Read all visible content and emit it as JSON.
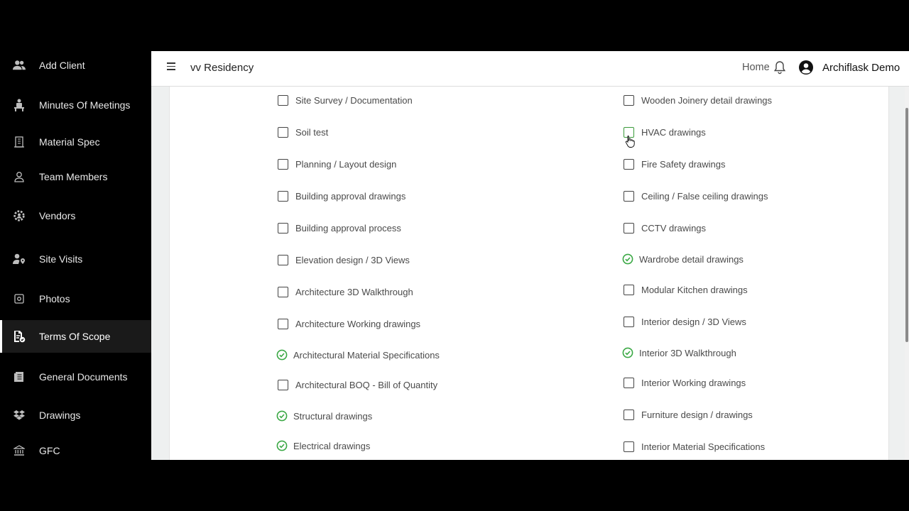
{
  "header": {
    "project_name": "vv Residency",
    "home_label": "Home",
    "user_name": "Archiflask Demo"
  },
  "sidebar": {
    "items": [
      {
        "label": "Add Client",
        "icon": "users-icon",
        "active": false
      },
      {
        "label": "Minutes Of Meetings",
        "icon": "meeting-icon",
        "active": false
      },
      {
        "label": "Material Spec",
        "icon": "building-icon",
        "active": false
      },
      {
        "label": "Team Members",
        "icon": "user-outline-icon",
        "active": false
      },
      {
        "label": "Vendors",
        "icon": "gear-user-icon",
        "active": false
      },
      {
        "label": "Site Visits",
        "icon": "user-location-icon",
        "active": false
      },
      {
        "label": "Photos",
        "icon": "photo-icon",
        "active": false
      },
      {
        "label": "Terms Of Scope",
        "icon": "document-check-icon",
        "active": true
      },
      {
        "label": "General Documents",
        "icon": "documents-icon",
        "active": false
      },
      {
        "label": "Drawings",
        "icon": "dropbox-icon",
        "active": false
      },
      {
        "label": "GFC",
        "icon": "bank-icon",
        "active": false
      }
    ]
  },
  "scope": {
    "left": [
      {
        "label": "Site Survey / Documentation",
        "done": false
      },
      {
        "label": "Soil test",
        "done": false
      },
      {
        "label": "Planning / Layout design",
        "done": false
      },
      {
        "label": "Building approval drawings",
        "done": false
      },
      {
        "label": "Building approval process",
        "done": false
      },
      {
        "label": "Elevation design / 3D Views",
        "done": false
      },
      {
        "label": "Architecture 3D Walkthrough",
        "done": false
      },
      {
        "label": "Architecture Working drawings",
        "done": false
      },
      {
        "label": "Architectural Material Specifications",
        "done": true
      },
      {
        "label": "Architectural BOQ - Bill of Quantity",
        "done": false
      },
      {
        "label": "Structural drawings",
        "done": true
      },
      {
        "label": "Electrical drawings",
        "done": true
      }
    ],
    "right": [
      {
        "label": "Wooden Joinery detail drawings",
        "done": false
      },
      {
        "label": "HVAC drawings",
        "done": false,
        "hover": true
      },
      {
        "label": "Fire Safety drawings",
        "done": false
      },
      {
        "label": "Ceiling / False ceiling drawings",
        "done": false
      },
      {
        "label": "CCTV drawings",
        "done": false
      },
      {
        "label": "Wardrobe detail drawings",
        "done": true
      },
      {
        "label": "Modular Kitchen drawings",
        "done": false
      },
      {
        "label": "Interior design / 3D Views",
        "done": false
      },
      {
        "label": "Interior 3D Walkthrough",
        "done": true
      },
      {
        "label": "Interior Working drawings",
        "done": false
      },
      {
        "label": "Furniture design / drawings",
        "done": false
      },
      {
        "label": "Interior Material Specifications",
        "done": false
      }
    ]
  },
  "colors": {
    "check_green": "#3aa844",
    "sidebar_bg": "#000000",
    "content_bg": "#ffffff"
  }
}
